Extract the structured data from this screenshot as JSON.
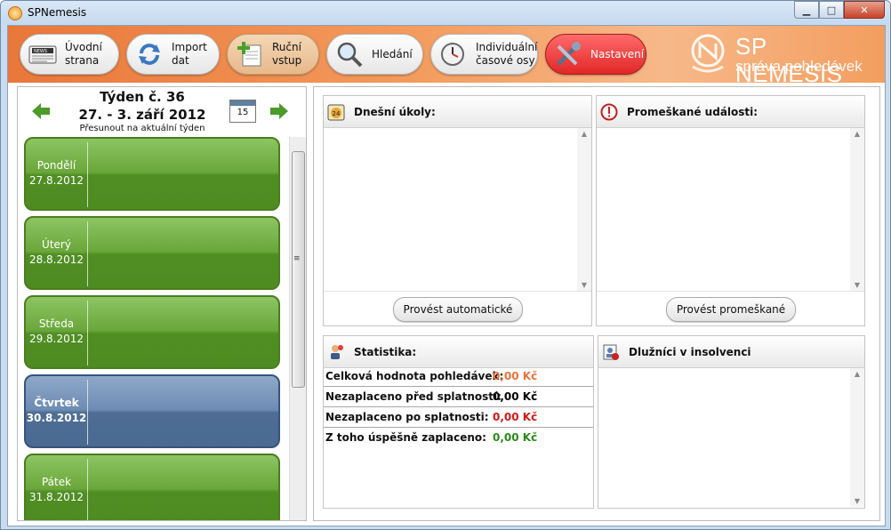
{
  "window": {
    "title": "SPNemesis"
  },
  "toolbar": {
    "items": [
      {
        "label": "Úvodní\nstrana"
      },
      {
        "label": "Import\ndat"
      },
      {
        "label": "Ruční\nvstup"
      },
      {
        "label": "Hledání"
      },
      {
        "label": "Individuální\nčasové osy"
      },
      {
        "label": "Nastavení"
      }
    ]
  },
  "brand": {
    "name": "SP NEMESIS",
    "tagline": "správa pohledávek"
  },
  "week": {
    "title": "Týden č. 36",
    "range": "27. - 3. září 2012",
    "move_label": "Přesunout na aktuální týden",
    "calendar_day": "15"
  },
  "days": [
    {
      "name": "Pondělí",
      "date": "27.8.2012"
    },
    {
      "name": "Úterý",
      "date": "28.8.2012"
    },
    {
      "name": "Středa",
      "date": "29.8.2012"
    },
    {
      "name": "Čtvrtek",
      "date": "30.8.2012"
    },
    {
      "name": "Pátek",
      "date": "31.8.2012"
    }
  ],
  "panels": {
    "today": {
      "title": "Dnešní úkoly:",
      "button": "Provést automatické"
    },
    "missed": {
      "title": "Promeškané události:",
      "button": "Provést promeškané"
    },
    "stats": {
      "title": "Statistika:",
      "rows": [
        {
          "label": "Celková hodnota pohledávek:",
          "value": "0,00 Kč",
          "color": "#e8733a"
        },
        {
          "label": "Nezaplaceno před splatností:",
          "value": "0,00 Kč",
          "color": "#000000"
        },
        {
          "label": "Nezaplaceno po splatnosti:",
          "value": "0,00 Kč",
          "color": "#d01818"
        },
        {
          "label": "Z toho úspěšně zaplaceno:",
          "value": "0,00 Kč",
          "color": "#2a8a1a"
        }
      ]
    },
    "insolvency": {
      "title": "Dlužníci v insolvenci"
    }
  },
  "colors": {
    "toolbar_accent": "#f39a5c",
    "day_green": "#6aa63a",
    "day_selected": "#6d8cb3"
  }
}
